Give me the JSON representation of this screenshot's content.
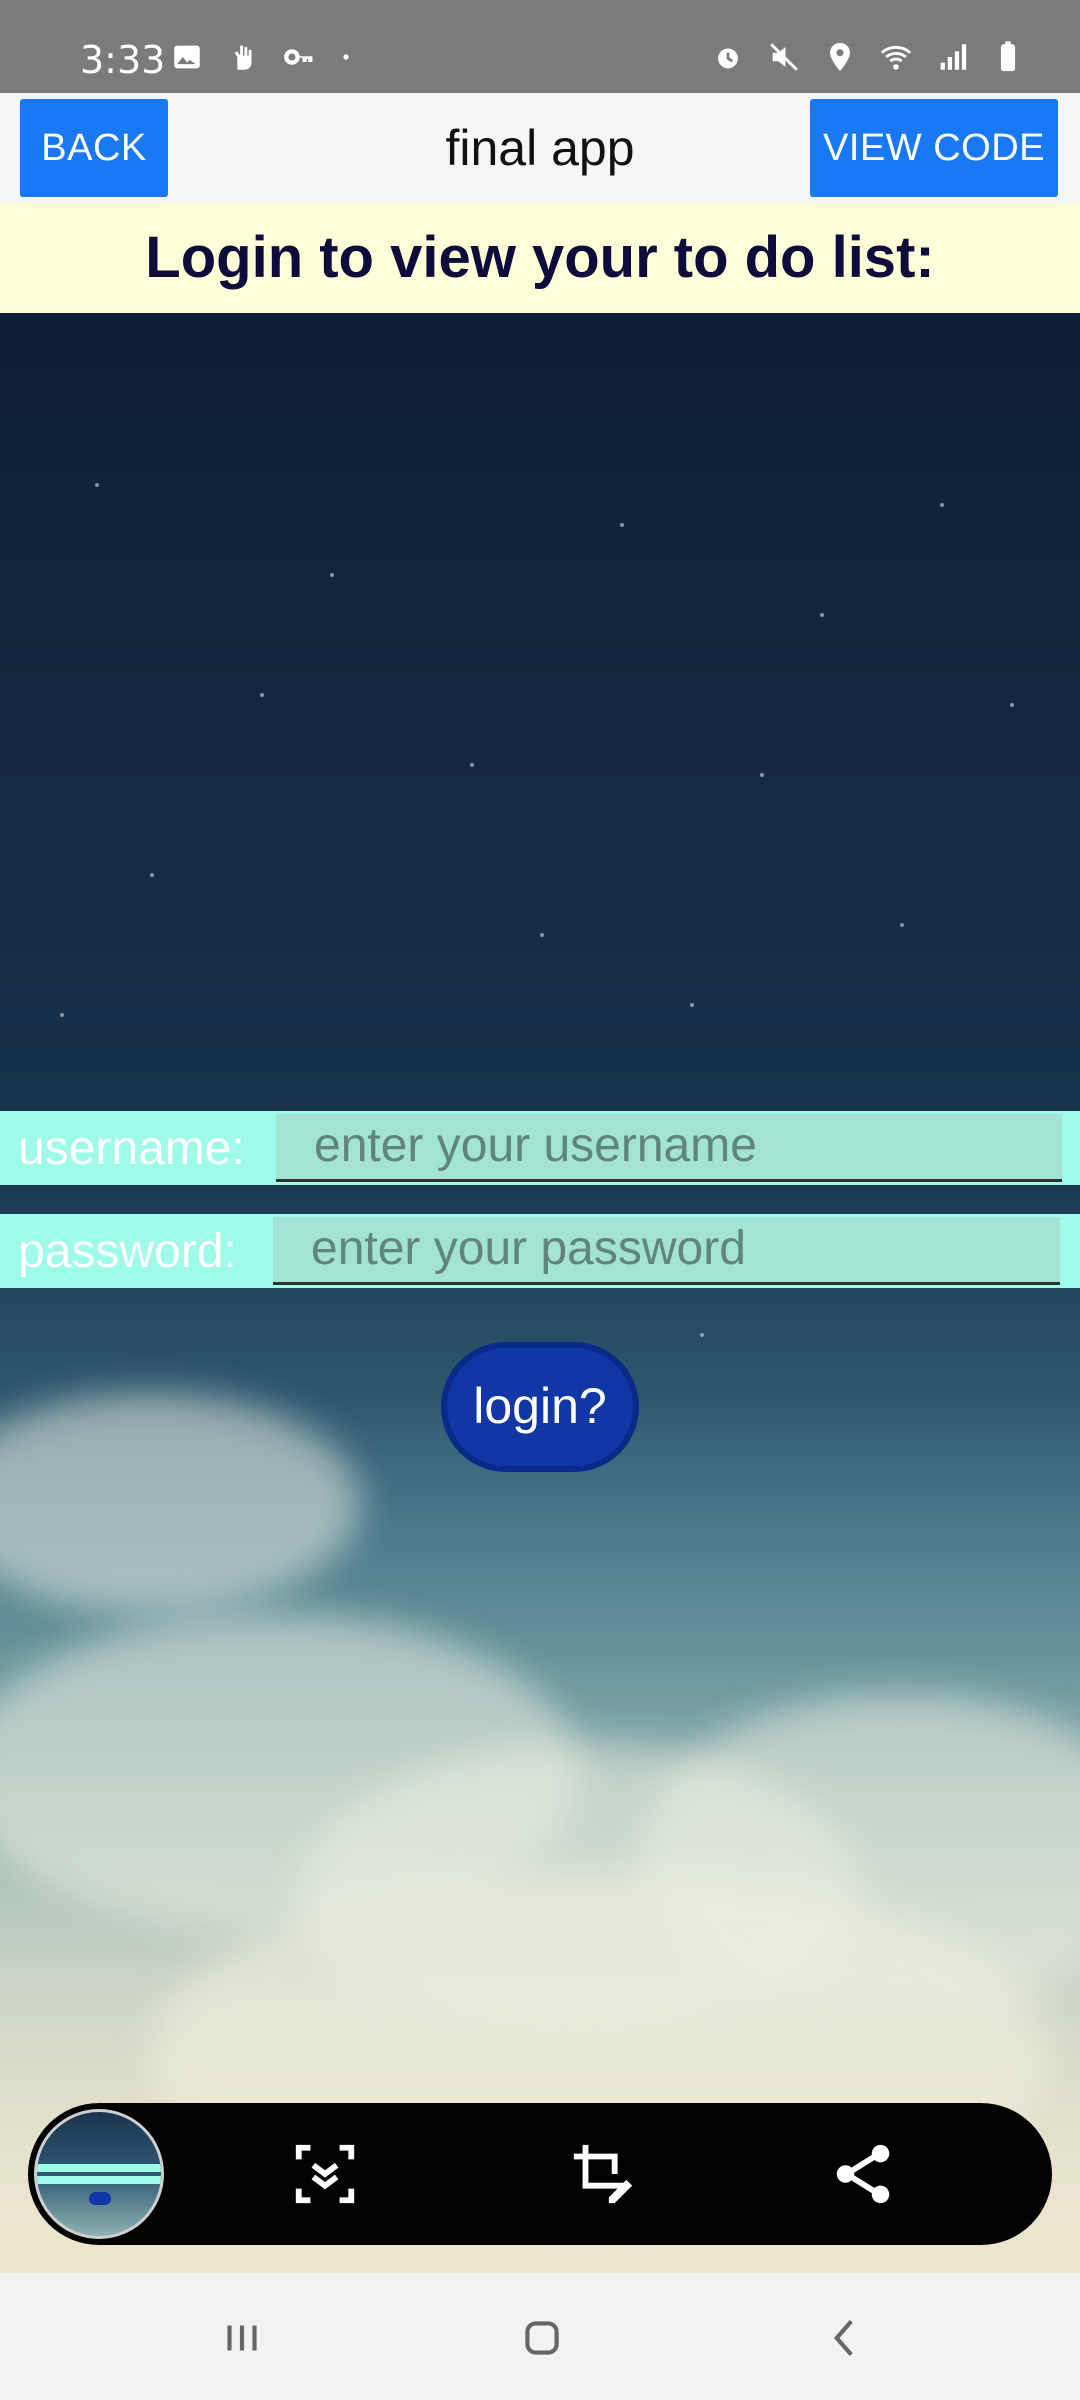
{
  "status_bar": {
    "time": "3:33",
    "left_icons": [
      "image-icon",
      "hand-icon",
      "key-icon",
      "dot-icon"
    ],
    "right_icons": [
      "alarm-icon",
      "mute-icon",
      "location-icon",
      "wifi-icon",
      "signal-icon",
      "battery-icon"
    ]
  },
  "header": {
    "back_label": "BACK",
    "title": "final app",
    "view_code_label": "VIEW CODE"
  },
  "subtitle": "Login to view your to do list:",
  "form": {
    "username_label": "username:",
    "username_placeholder": "enter your username",
    "password_label": "password:",
    "password_placeholder": "enter your password",
    "login_label": "login?"
  },
  "screenshot_toolbar": {
    "icons": [
      "screenshot-thumbnail",
      "scroll-capture-icon",
      "crop-edit-icon",
      "share-icon"
    ]
  },
  "nav_bar": {
    "icons": [
      "recents-icon",
      "home-icon",
      "back-nav-icon"
    ]
  },
  "colors": {
    "header_button": "#1978f4",
    "subtitle_bg": "#fdfed8",
    "form_row_bg": "#9dfbe8",
    "login_button": "#1037a5"
  }
}
